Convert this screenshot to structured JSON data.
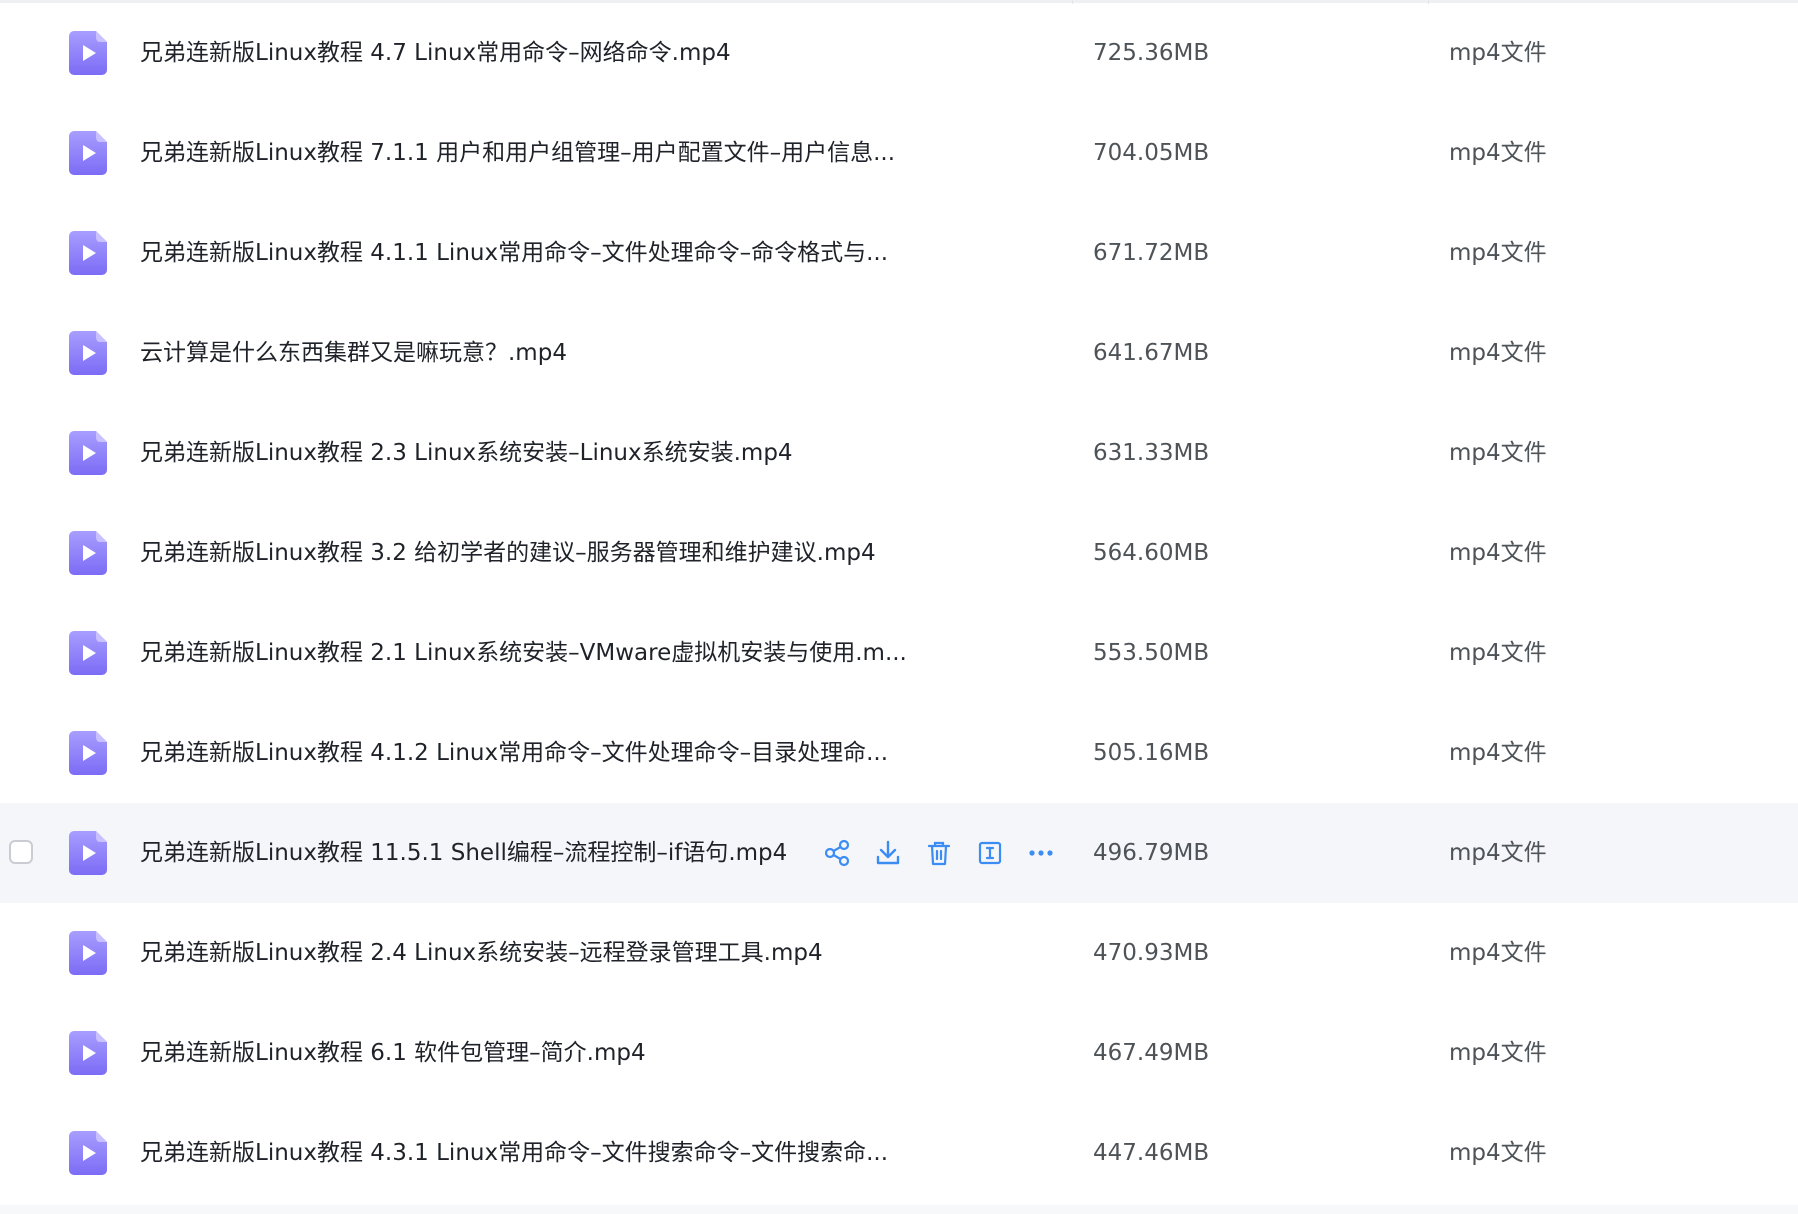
{
  "colors": {
    "accent": "#3b8cf3",
    "icon_gradient_top": "#a89dff",
    "icon_gradient_bottom": "#7c6cf5",
    "hover_row": "#f5f6fa"
  },
  "files": [
    {
      "name": "兄弟连新版Linux教程 4.7 Linux常用命令–网络命令.mp4",
      "size": "725.36MB",
      "type": "mp4文件",
      "icon": "video-file-icon"
    },
    {
      "name": "兄弟连新版Linux教程 7.1.1 用户和用户组管理–用户配置文件–用户信息...",
      "size": "704.05MB",
      "type": "mp4文件",
      "icon": "video-file-icon"
    },
    {
      "name": "兄弟连新版Linux教程 4.1.1 Linux常用命令–文件处理命令–命令格式与...",
      "size": "671.72MB",
      "type": "mp4文件",
      "icon": "video-file-icon"
    },
    {
      "name": "云计算是什么东西集群又是嘛玩意？.mp4",
      "size": "641.67MB",
      "type": "mp4文件",
      "icon": "video-file-icon"
    },
    {
      "name": "兄弟连新版Linux教程 2.3 Linux系统安装–Linux系统安装.mp4",
      "size": "631.33MB",
      "type": "mp4文件",
      "icon": "video-file-icon"
    },
    {
      "name": "兄弟连新版Linux教程 3.2 给初学者的建议–服务器管理和维护建议.mp4",
      "size": "564.60MB",
      "type": "mp4文件",
      "icon": "video-file-icon"
    },
    {
      "name": "兄弟连新版Linux教程 2.1 Linux系统安装–VMware虚拟机安装与使用.m...",
      "size": "553.50MB",
      "type": "mp4文件",
      "icon": "video-file-icon"
    },
    {
      "name": "兄弟连新版Linux教程 4.1.2 Linux常用命令–文件处理命令–目录处理命...",
      "size": "505.16MB",
      "type": "mp4文件",
      "icon": "video-file-icon"
    },
    {
      "name": "兄弟连新版Linux教程 11.5.1 Shell编程–流程控制–if语句.mp4",
      "size": "496.79MB",
      "type": "mp4文件",
      "icon": "video-file-icon",
      "hovered": true,
      "actions": [
        "share-icon",
        "download-icon",
        "delete-icon",
        "rename-icon",
        "more-icon"
      ]
    },
    {
      "name": "兄弟连新版Linux教程 2.4 Linux系统安装–远程登录管理工具.mp4",
      "size": "470.93MB",
      "type": "mp4文件",
      "icon": "video-file-icon"
    },
    {
      "name": "兄弟连新版Linux教程 6.1 软件包管理–简介.mp4",
      "size": "467.49MB",
      "type": "mp4文件",
      "icon": "video-file-icon"
    },
    {
      "name": "兄弟连新版Linux教程 4.3.1 Linux常用命令–文件搜索命令–文件搜索命...",
      "size": "447.46MB",
      "type": "mp4文件",
      "icon": "video-file-icon"
    }
  ]
}
